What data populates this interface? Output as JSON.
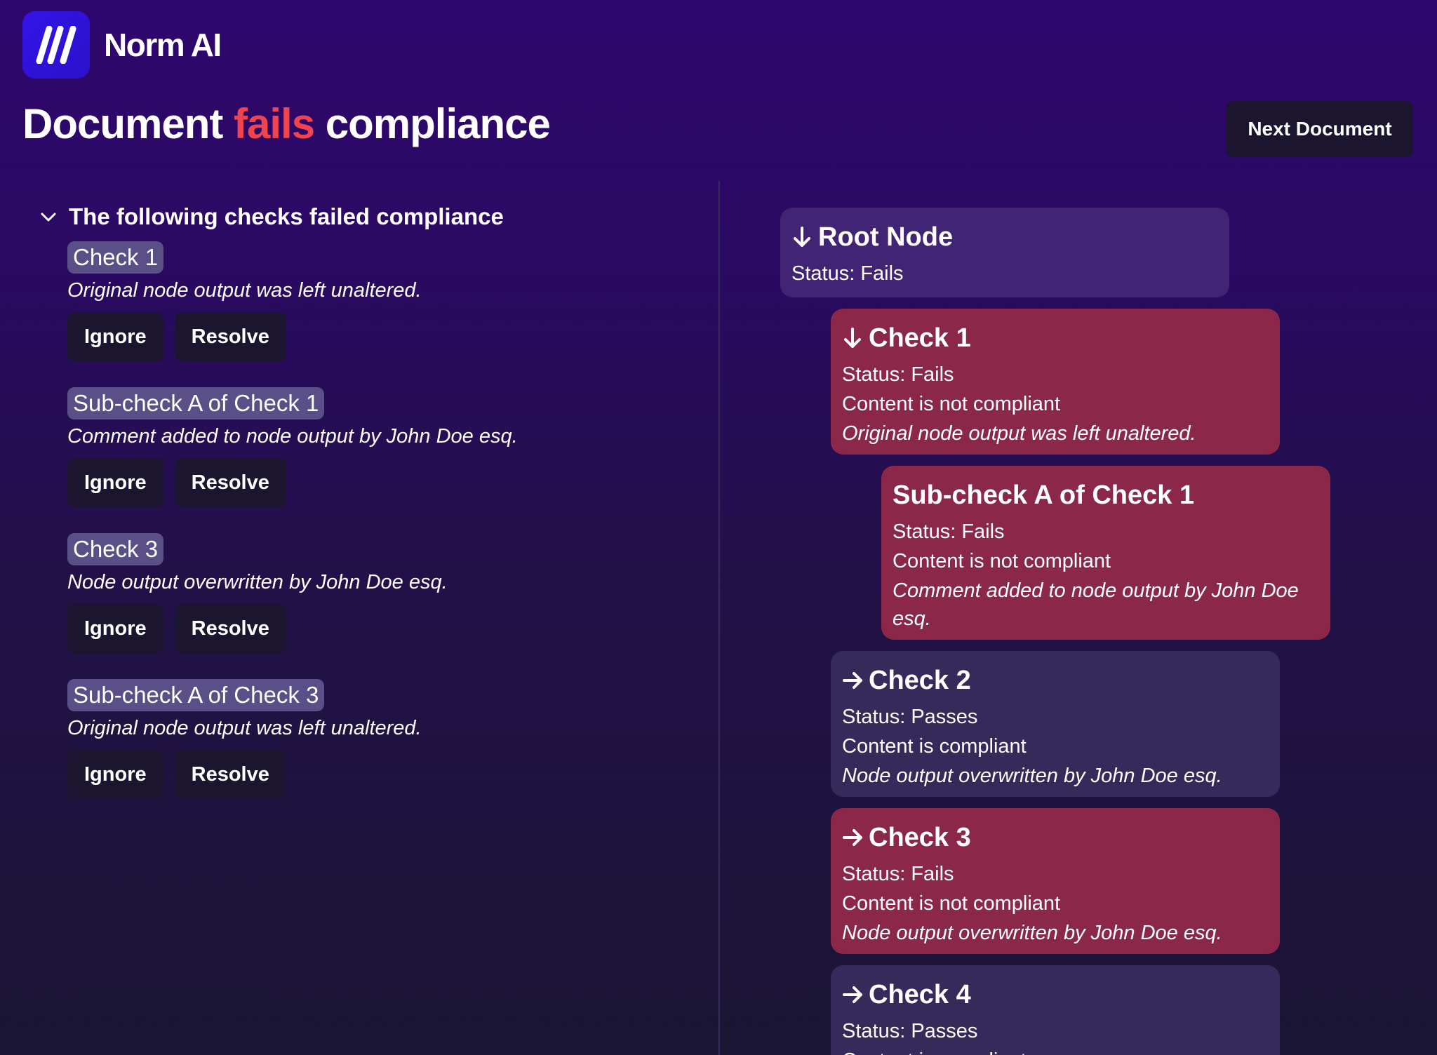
{
  "brand": {
    "name": "Norm AI"
  },
  "page": {
    "title_prefix": "Document",
    "title_status": "fails",
    "title_suffix": "compliance",
    "next_button": "Next Document"
  },
  "colors": {
    "fail_accent": "#f0454f",
    "fail_card": "#8b2748",
    "pass_card": "#362a5a",
    "root_card": "#422474"
  },
  "failed_checks": {
    "heading": "The following checks failed compliance",
    "items": [
      {
        "label": "Check 1",
        "description": "Original node output was left unaltered.",
        "ignore": "Ignore",
        "resolve": "Resolve"
      },
      {
        "label": "Sub-check A of Check 1",
        "description": "Comment added to node output by John Doe esq.",
        "ignore": "Ignore",
        "resolve": "Resolve"
      },
      {
        "label": "Check 3",
        "description": "Node output overwritten by John Doe esq.",
        "ignore": "Ignore",
        "resolve": "Resolve"
      },
      {
        "label": "Sub-check A of Check 3",
        "description": "Original node output was left unaltered.",
        "ignore": "Ignore",
        "resolve": "Resolve"
      }
    ]
  },
  "tree": {
    "root": {
      "icon": "arrow-down-icon",
      "title": "Root Node",
      "status": "Status: Fails"
    },
    "check1": {
      "icon": "arrow-down-icon",
      "title": "Check 1",
      "status": "Status: Fails",
      "compliance": "Content is not compliant",
      "note": "Original node output was left unaltered."
    },
    "subcheck_a1": {
      "title": "Sub-check A of Check 1",
      "status": "Status: Fails",
      "compliance": "Content is not compliant",
      "note": "Comment added to node output by John Doe esq."
    },
    "check2": {
      "icon": "arrow-right-icon",
      "title": "Check 2",
      "status": "Status: Passes",
      "compliance": "Content is compliant",
      "note": "Node output overwritten by John Doe esq."
    },
    "check3": {
      "icon": "arrow-right-icon",
      "title": "Check 3",
      "status": "Status: Fails",
      "compliance": "Content is not compliant",
      "note": "Node output overwritten by John Doe esq."
    },
    "check4": {
      "icon": "arrow-right-icon",
      "title": "Check 4",
      "status": "Status: Passes",
      "compliance": "Content is compliant"
    }
  }
}
